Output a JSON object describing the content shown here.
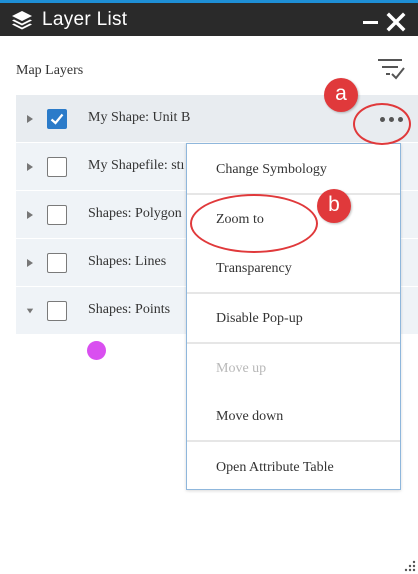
{
  "window": {
    "title": "Layer List",
    "accent_color": "#1e8fd6",
    "icons": [
      "layers-icon",
      "minimize-icon",
      "close-icon",
      "filter-icon",
      "resize-grip-icon"
    ]
  },
  "panel": {
    "section_label": "Map Layers"
  },
  "layers": [
    {
      "label": "My Shape: Unit B",
      "checked": true,
      "expanded": false
    },
    {
      "label": "My Shapefile: stı",
      "checked": false,
      "expanded": false
    },
    {
      "label": "Shapes: Polygon",
      "checked": false,
      "expanded": false
    },
    {
      "label": "Shapes: Lines",
      "checked": false,
      "expanded": false
    },
    {
      "label": "Shapes: Points",
      "checked": false,
      "expanded": true
    }
  ],
  "legend": {
    "point_symbol_color": "#d94ff0"
  },
  "context_menu": {
    "items": [
      {
        "label": "Change Symbology",
        "enabled": true
      },
      {
        "label": "Zoom to",
        "enabled": true
      },
      {
        "label": "Transparency",
        "enabled": true
      },
      {
        "label": "Disable Pop-up",
        "enabled": true
      },
      {
        "label": "Move up",
        "enabled": false
      },
      {
        "label": "Move down",
        "enabled": true
      },
      {
        "label": "Open Attribute Table",
        "enabled": true
      }
    ]
  },
  "callouts": {
    "a": "a",
    "b": "b",
    "color": "#e0393b"
  }
}
